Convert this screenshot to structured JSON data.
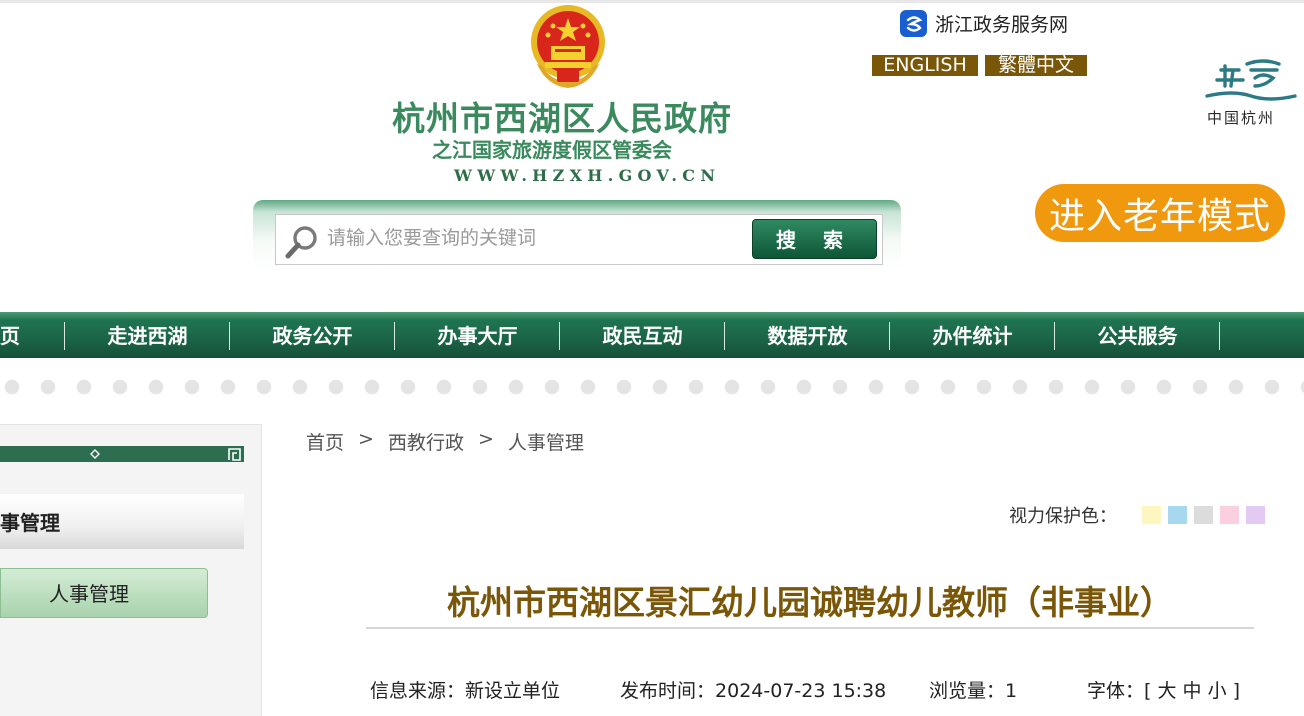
{
  "header": {
    "gov_name": "杭州市西湖区人民政府",
    "gov_sub": "之江国家旅游度假区管委会",
    "gov_url": "WWW.HZXH.GOV.CN",
    "zhejiang_link": "浙江政务服务网",
    "lang_english": "ENGLISH",
    "lang_traditional": "繁體中文",
    "hangzhou_logo_text": "中国杭州",
    "elder_mode": "进入老年模式"
  },
  "search": {
    "placeholder": "请输入您要查询的关键词",
    "button": "搜 索"
  },
  "nav": {
    "items": [
      "首页",
      "走进西湖",
      "政务公开",
      "办事大厅",
      "政民互动",
      "数据开放",
      "办件统计",
      "公共服务"
    ]
  },
  "sidebar": {
    "title": "人事管理",
    "item": "人事管理"
  },
  "breadcrumb": {
    "items": [
      "首页",
      "西教行政",
      "人事管理"
    ],
    "separator": ">"
  },
  "eye_protect": {
    "label": "视力保护色：",
    "colors": [
      "#fdf6c0",
      "#a8d8f0",
      "#dcdcdc",
      "#fbcfe0",
      "#e2caf5"
    ]
  },
  "article": {
    "title": "杭州市西湖区景汇幼儿园诚聘幼儿教师（非事业）",
    "source_label": "信息来源：",
    "source": "新设立单位",
    "time_label": "发布时间：",
    "time": "2024-07-23 15:38",
    "views_label": "浏览量：",
    "views": "1",
    "font_label": "字体：",
    "font_open": "[",
    "font_large": "大",
    "font_medium": "中",
    "font_small": "小",
    "font_close": "]"
  },
  "colors": {
    "brand_green": "#1f7450",
    "title_brown": "#7a5608",
    "elder_orange": "#f0980e"
  }
}
